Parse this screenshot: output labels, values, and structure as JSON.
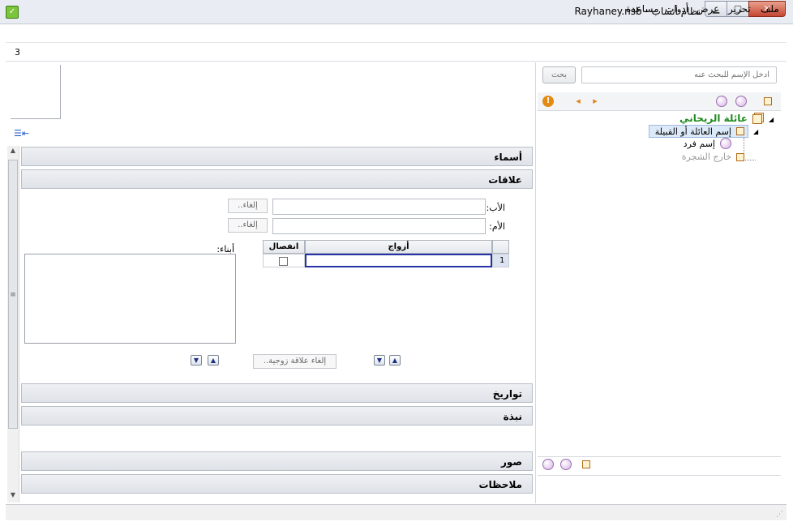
{
  "window": {
    "title": "Rayhaney.nsb - نظام أنساب"
  },
  "menu": {
    "items": [
      "ملف",
      "تحرير",
      "عرض",
      "أدوات",
      "مساعدة"
    ]
  },
  "indicator": "3",
  "sections": {
    "names": "أسماء",
    "relations": "علاقات",
    "dates": "تواريخ",
    "summary": "نبذة",
    "photos": "صور",
    "notes": "ملاحظات"
  },
  "relations": {
    "father_label": "الأب:",
    "mother_label": "الأم:",
    "cancel_label": "إلغاء..",
    "children_label": "أبناء:",
    "cancel_marriage_label": "إلغاء علاقة زوجية..",
    "grid": {
      "col_spouses": "أزواج",
      "col_separation": "انفصال",
      "row_number": "1"
    }
  },
  "search": {
    "placeholder": "أدخل الإسم للبحث عنه",
    "button": "بحث"
  },
  "tree": {
    "root": "عائلة الريحاني",
    "family": "إسم العائلة أو القبيلة",
    "individual": "إسم فرد",
    "outside": "خارج الشجرة"
  },
  "colors": {
    "root_green": "#1f8a1f",
    "selection": "#dce9f8",
    "accent_blue": "#1b2f86"
  }
}
